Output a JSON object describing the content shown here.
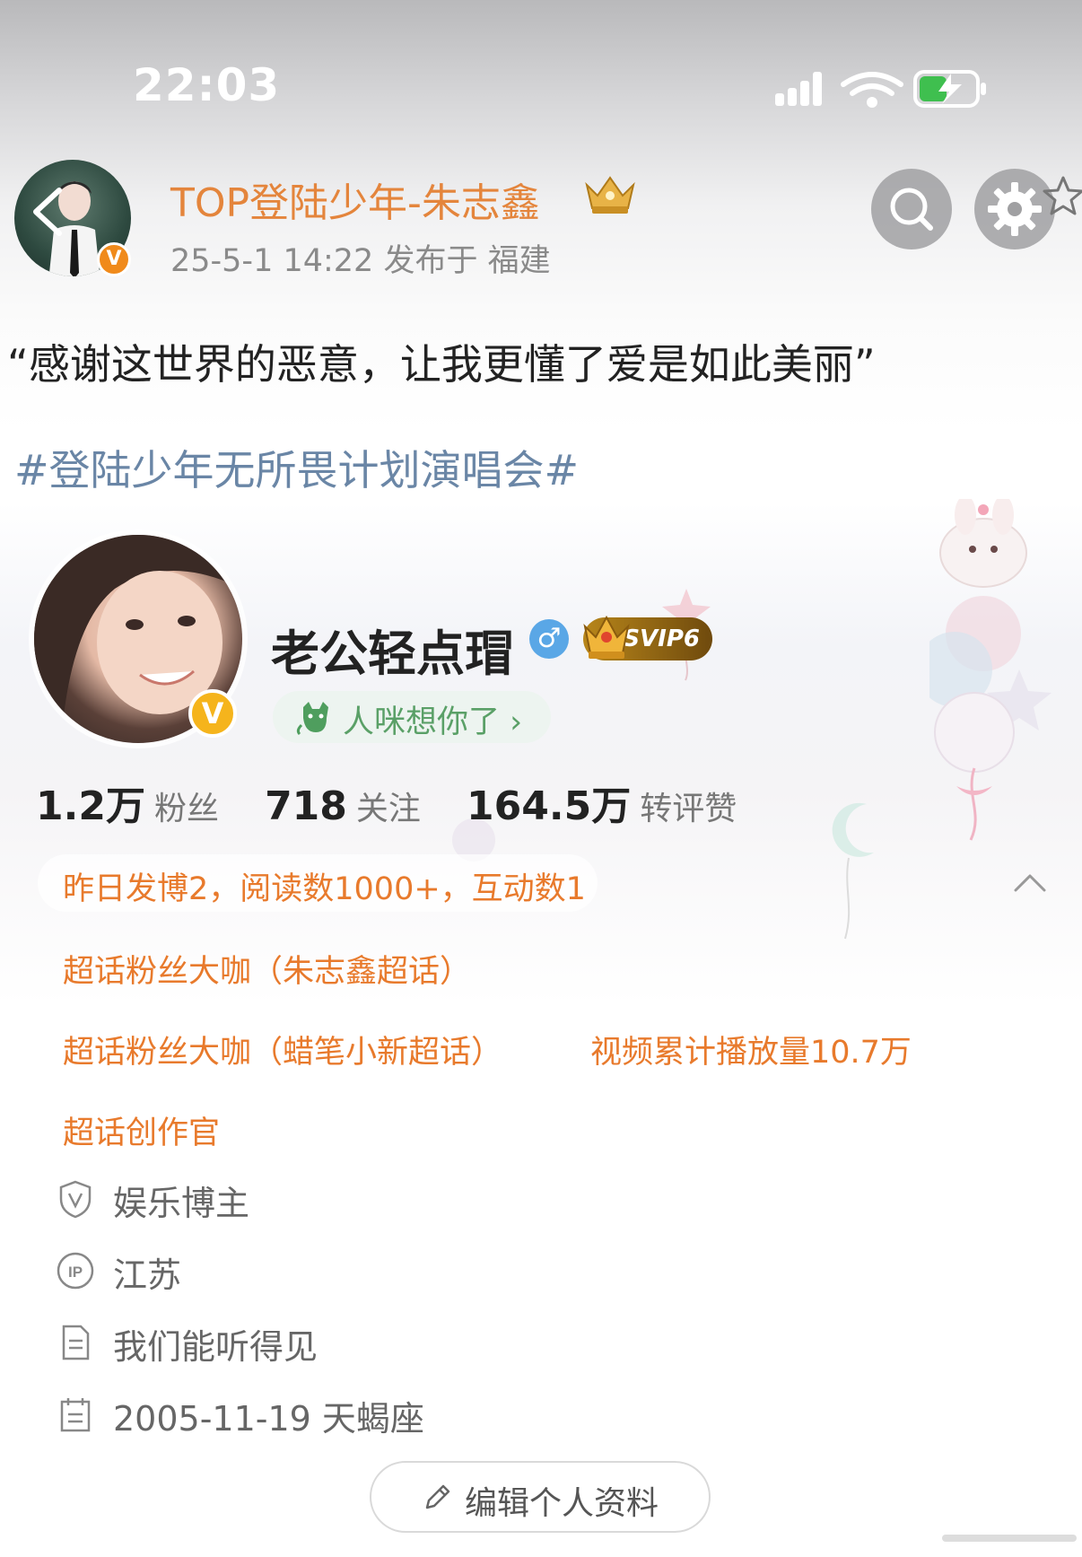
{
  "status_bar": {
    "time": "22:03",
    "icons": [
      "signal-icon",
      "wifi-icon",
      "battery-charging-icon"
    ],
    "battery_color": "#3fbf4f"
  },
  "header": {
    "author_name": "TOP登陆少年-朱志鑫",
    "post_meta": "25-5-1 14:22  发布于 福建",
    "verified_badge": "V",
    "author_name_color": "#e4853c",
    "buttons": [
      "back-icon",
      "search-icon",
      "settings-icon",
      "star-icon"
    ]
  },
  "post": {
    "text": "“感谢这世界的恶意，让我更懂了爱是如此美丽”",
    "hashtag": "#登陆少年无所畏计划演唱会#",
    "hashtag_color": "#6a86a6"
  },
  "profile": {
    "nickname": "老公轻点瑁",
    "gender_symbol": "♂",
    "vip_badge": "SVIP6",
    "verified_badge": "V",
    "status_text": "人咪想你了 ›",
    "stats": [
      {
        "value": "1.2万",
        "label": "粉丝"
      },
      {
        "value": "718",
        "label": "关注"
      },
      {
        "value": "164.5万",
        "label": "转评赞"
      }
    ],
    "activity": "昨日发博2，阅读数1000+，互动数1",
    "tags": {
      "tag1": "超话粉丝大咖（朱志鑫超话）",
      "tag2": "超话粉丝大咖（蜡笔小新超话）",
      "tag3": "视频累计播放量10.7万",
      "tag4": "超话创作官"
    },
    "tag_color": "#e87a2c",
    "info": {
      "category": "娱乐博主",
      "ip_location": "江苏",
      "bio": "我们能听得见",
      "birthday": "2005-11-19 天蝎座"
    },
    "edit_button": "编辑个人资料"
  }
}
